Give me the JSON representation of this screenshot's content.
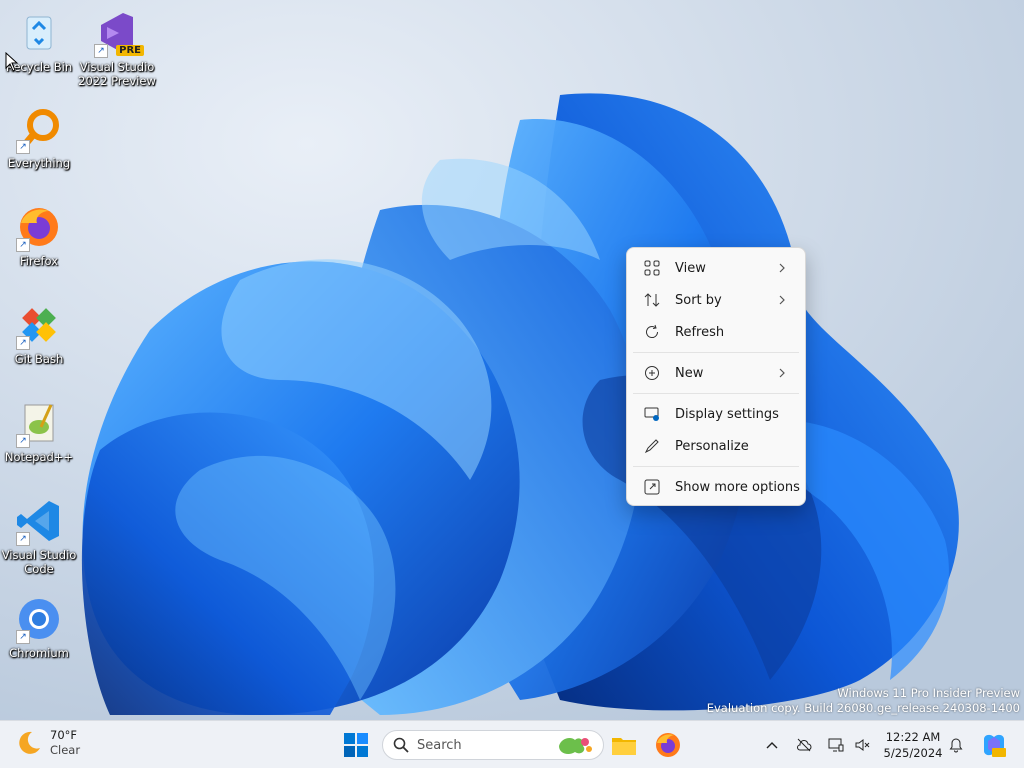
{
  "desktop_icons": [
    {
      "label": "Recycle Bin",
      "icon": "recycle-bin-icon"
    },
    {
      "label": "Visual Studio 2022 Preview",
      "icon": "visual-studio-preview-icon",
      "badge": "PRE"
    },
    {
      "label": "Everything",
      "icon": "everything-search-icon"
    },
    {
      "label": "Firefox",
      "icon": "firefox-icon"
    },
    {
      "label": "Git Bash",
      "icon": "git-bash-icon"
    },
    {
      "label": "Notepad++",
      "icon": "notepad-plus-plus-icon"
    },
    {
      "label": "Visual Studio Code",
      "icon": "vscode-icon"
    },
    {
      "label": "Chromium",
      "icon": "chromium-icon"
    }
  ],
  "context_menu": {
    "items": [
      {
        "label": "View",
        "icon": "grid-view-icon",
        "has_submenu": true
      },
      {
        "label": "Sort by",
        "icon": "sort-icon",
        "has_submenu": true
      },
      {
        "label": "Refresh",
        "icon": "refresh-icon",
        "has_submenu": false
      },
      {
        "label": "New",
        "icon": "plus-circle-icon",
        "has_submenu": true
      },
      {
        "label": "Display settings",
        "icon": "display-settings-icon",
        "has_submenu": false
      },
      {
        "label": "Personalize",
        "icon": "pen-icon",
        "has_submenu": false
      },
      {
        "label": "Show more options",
        "icon": "expand-icon",
        "has_submenu": false
      }
    ]
  },
  "watermark": {
    "line1": "Windows 11 Pro Insider Preview",
    "line2": "Evaluation copy. Build 26080.ge_release.240308-1400"
  },
  "taskbar": {
    "weather": {
      "temp": "70°F",
      "condition": "Clear"
    },
    "search_placeholder": "Search",
    "clock": {
      "time": "12:22 AM",
      "date": "5/25/2024"
    }
  },
  "colors": {
    "accent": "#0067c0",
    "taskbar_bg": "#eef1f6",
    "menu_bg": "#f9f9f9"
  }
}
